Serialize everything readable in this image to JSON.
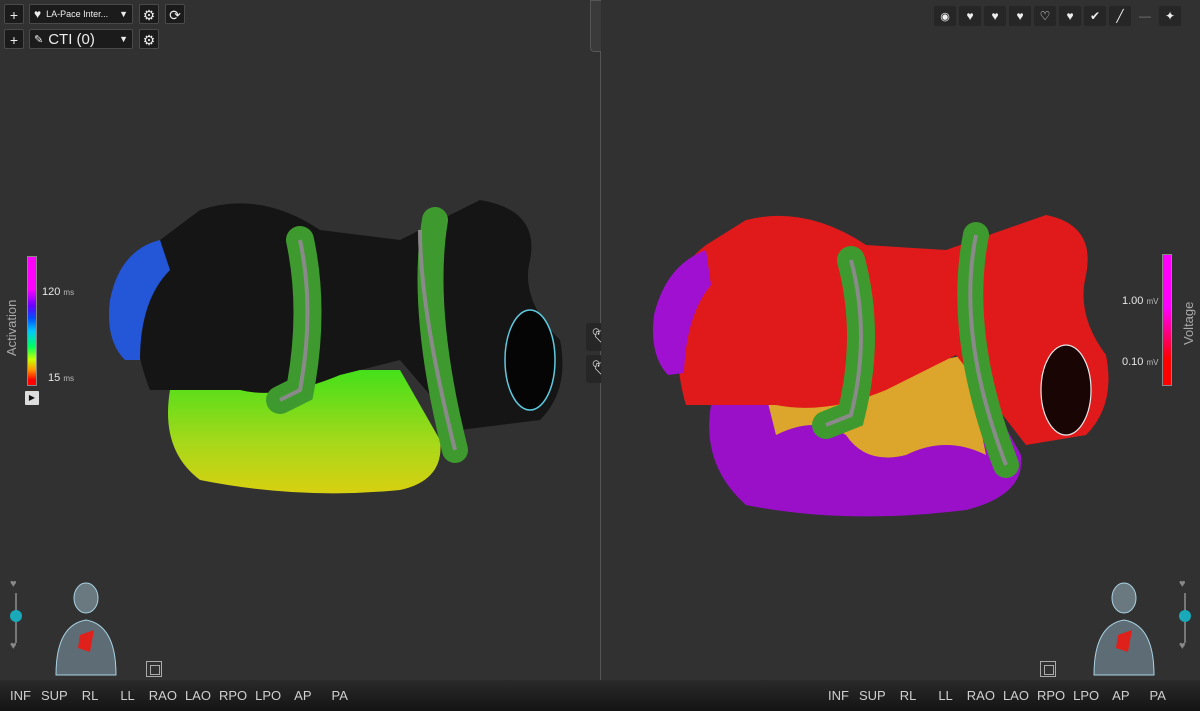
{
  "left_panel": {
    "toolbar": {
      "add_label": "+",
      "map_select": "LA-Pace Inter...",
      "catheter_select": "CTI (0)"
    },
    "scale": {
      "title": "Activation",
      "high_value": "120",
      "high_unit": "ms",
      "low_value": "15",
      "low_unit": "ms"
    },
    "views": [
      "INF",
      "SUP",
      "RL",
      "LL",
      "RAO",
      "LAO",
      "RPO",
      "LPO",
      "AP",
      "PA"
    ]
  },
  "right_panel": {
    "scale": {
      "title": "Voltage",
      "high_value": "1.00",
      "high_unit": "mV",
      "low_value": "0.10",
      "low_unit": "mV"
    },
    "views": [
      "INF",
      "SUP",
      "RL",
      "LL",
      "RAO",
      "LAO",
      "RPO",
      "LPO",
      "AP",
      "PA"
    ]
  },
  "icons": {
    "toolbar": [
      "target-icon",
      "heart-left-icon",
      "heart-right-icon",
      "heart-lock-icon",
      "heart-outline-icon",
      "heart-fill-icon",
      "heart-check-icon",
      "ruler-icon",
      "minimize-icon",
      "satellite-icon"
    ]
  },
  "colors": {
    "activation_gradient": [
      "#ff00ff",
      "#6a00ff",
      "#0050ff",
      "#00c8ff",
      "#00ff60",
      "#c8ff00",
      "#ff9900",
      "#ff0000"
    ],
    "voltage_gradient": [
      "#ff00ff",
      "#ff00ff",
      "#ff0000"
    ],
    "accent": "#19a9b8"
  }
}
